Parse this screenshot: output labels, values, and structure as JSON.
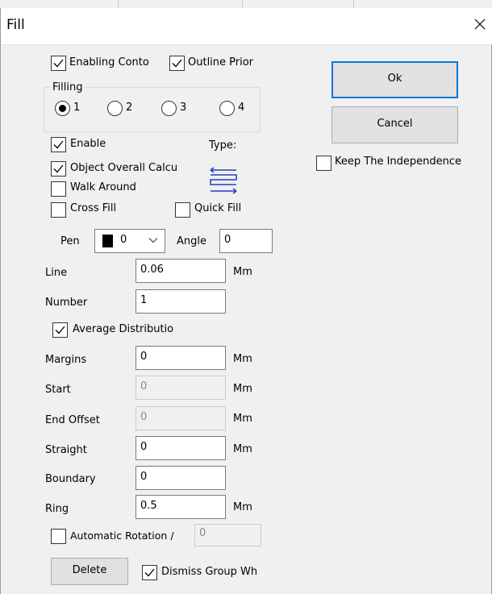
{
  "title": "Fill",
  "buttons": {
    "ok": "Ok",
    "cancel": "Cancel",
    "delete": "Delete"
  },
  "checks": {
    "enabling_conto": {
      "label": "Enabling Conto",
      "checked": true
    },
    "outline_prior": {
      "label": "Outline Prior",
      "checked": true
    },
    "keep_independence": {
      "label": "Keep The Independence",
      "checked": false
    },
    "enable": {
      "label": "Enable",
      "checked": true
    },
    "object_overall": {
      "label": "Object Overall Calcu",
      "checked": true
    },
    "walk_around": {
      "label": "Walk Around",
      "checked": false
    },
    "cross_fill": {
      "label": "Cross Fill",
      "checked": false
    },
    "quick_fill": {
      "label": "Quick Fill",
      "checked": false
    },
    "average_distribution": {
      "label": "Average Distributio",
      "checked": true
    },
    "automatic_rotation": {
      "label": "Automatic Rotation /",
      "checked": false
    },
    "dismiss_group": {
      "label": "Dismiss Group Wh",
      "checked": true
    }
  },
  "filling": {
    "label": "Filling",
    "options": [
      "1",
      "2",
      "3",
      "4"
    ],
    "selected": "1"
  },
  "type_label": "Type:",
  "pen": {
    "label": "Pen",
    "value": "0",
    "color": "#000000"
  },
  "angle": {
    "label": "Angle",
    "value": "0"
  },
  "fields": {
    "line": {
      "label": "Line",
      "value": "0.06",
      "unit": "Mm"
    },
    "number": {
      "label": "Number",
      "value": "1"
    },
    "margins": {
      "label": "Margins",
      "value": "0",
      "unit": "Mm"
    },
    "start": {
      "label": "Start",
      "value": "0",
      "unit": "Mm",
      "disabled": true
    },
    "end_offset": {
      "label": "End Offset",
      "value": "0",
      "unit": "Mm",
      "disabled": true
    },
    "straight": {
      "label": "Straight",
      "value": "0",
      "unit": "Mm"
    },
    "boundary": {
      "label": "Boundary",
      "value": "0"
    },
    "ring": {
      "label": "Ring",
      "value": "0.5",
      "unit": "Mm"
    },
    "rotation": {
      "value": "0",
      "disabled": true
    }
  },
  "colors": {
    "accent": "#0078d7",
    "type_icon": "#1f3fbf"
  }
}
